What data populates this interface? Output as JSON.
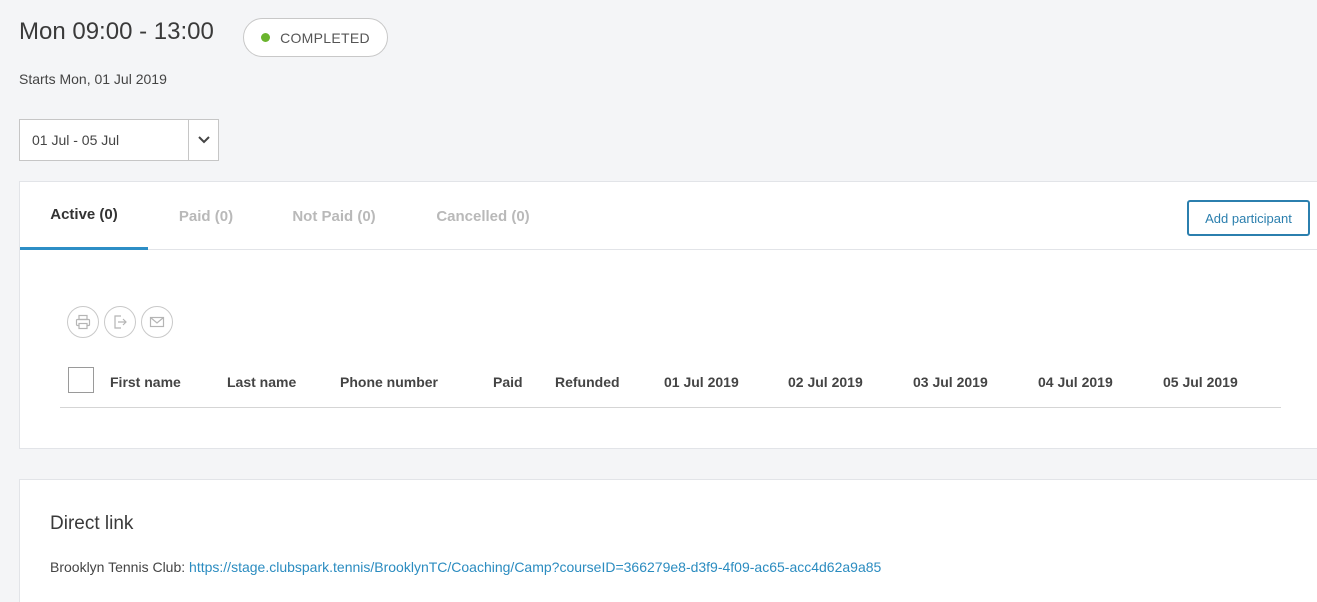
{
  "header": {
    "title": "Mon 09:00 - 13:00",
    "status": "COMPLETED",
    "status_color": "#6ab42d",
    "subtitle": "Starts Mon, 01 Jul 2019"
  },
  "week_select": {
    "value": "01 Jul - 05 Jul"
  },
  "tabs": [
    {
      "label": "Active (0)",
      "active": true
    },
    {
      "label": "Paid (0)",
      "active": false
    },
    {
      "label": "Not Paid (0)",
      "active": false
    },
    {
      "label": "Cancelled (0)",
      "active": false
    }
  ],
  "add_participant_label": "Add participant",
  "toolbar": {
    "icons": [
      "print-icon",
      "export-icon",
      "email-icon"
    ]
  },
  "table": {
    "columns": [
      "First name",
      "Last name",
      "Phone number",
      "Paid",
      "Refunded",
      "01 Jul 2019",
      "02 Jul 2019",
      "03 Jul 2019",
      "04 Jul 2019",
      "05 Jul 2019"
    ],
    "rows": []
  },
  "direct_link": {
    "title": "Direct link",
    "club": "Brooklyn Tennis Club:",
    "url": "https://stage.clubspark.tennis/BrooklynTC/Coaching/Camp?courseID=366279e8-d3f9-4f09-ac65-acc4d62a9a85"
  },
  "colors": {
    "accent": "#2d8ec6",
    "button": "#2b7fae",
    "link": "#2b8cc0"
  }
}
